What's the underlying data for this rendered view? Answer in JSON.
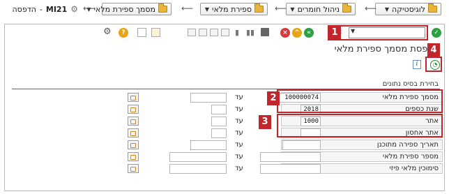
{
  "breadcrumb": {
    "items": [
      {
        "label": "לוגיסטיקה"
      },
      {
        "label": "ניהול חומרים"
      },
      {
        "label": "ספירת מלאי"
      },
      {
        "label": "מסמך ספירת מלאי"
      }
    ],
    "final": {
      "code": "MI21",
      "separator": "-",
      "label": "הדפסה"
    }
  },
  "window": {
    "title": "הדפסת מסמך ספירת מלאי",
    "command_field_value": "",
    "section_title": "בחירת בסיס נתונים",
    "to_label": "עד",
    "fields": [
      {
        "label": "מסמך ספירת מלאי",
        "from": "100000074",
        "to": ""
      },
      {
        "label": "שנת כספים",
        "from": "2018",
        "to": ""
      },
      {
        "label": "אתר",
        "from": "1000",
        "to": ""
      },
      {
        "label": "אתר אחסון",
        "from": "",
        "to": ""
      },
      {
        "label": "תאריך ספירה מתוכנן",
        "from": "",
        "to": ""
      },
      {
        "label": "מספר ספירת מלאי",
        "from": "",
        "to": ""
      },
      {
        "label": "סימוכין מלאי פיזי",
        "from": "",
        "to": ""
      }
    ]
  },
  "callouts": [
    "1",
    "2",
    "3",
    "4"
  ],
  "colors": {
    "callout": "#c0262c",
    "section_line": "#1b73c2",
    "folder": "#e8b53a"
  }
}
